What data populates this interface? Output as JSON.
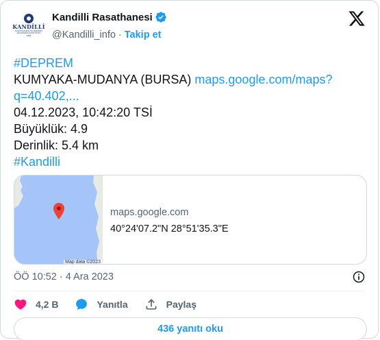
{
  "author": {
    "display_name": "Kandilli Rasathanesi",
    "handle": "@Kandilli_info",
    "separator": "·",
    "follow_label": "Takip et",
    "avatar_text": "KANDİLLİ",
    "avatar_subtext": "RASATHANESİ VE DEPREM ARAŞTIRMA ENSTİTÜSÜ 1868"
  },
  "tweet": {
    "hashtag_top": "#DEPREM",
    "location": "KUMYAKA-MUDANYA (BURSA)",
    "link_part1": "maps.google.com/maps?",
    "link_part2": "q=40.402,...",
    "datetime": "04.12.2023, 10:42:20 TSİ",
    "magnitude": "Büyüklük: 4.9",
    "depth": "Derinlik: 5.4 km",
    "hashtag_bottom": "#Kandilli"
  },
  "link_card": {
    "domain": "maps.google.com",
    "coordinates": "40°24'07.2\"N 28°51'35.3\"E",
    "map_credit": "Map data ©2023"
  },
  "meta": {
    "timestamp": "ÖÖ 10:52 · 4 Ara 2023"
  },
  "actions": {
    "like_count": "4,2 B",
    "reply_label": "Yanıtla",
    "share_label": "Paylaş"
  },
  "read_replies_label": "436 yanıtı oku",
  "colors": {
    "accent": "#1d9bf0",
    "like": "#f91880",
    "text": "#0f1419",
    "muted": "#536471",
    "map_water": "#a5c4f8",
    "pin": "#ea4335"
  },
  "icons": [
    "verified-badge-icon",
    "x-logo-icon",
    "map-pin-icon",
    "info-icon",
    "heart-icon",
    "reply-bubble-icon",
    "share-icon"
  ]
}
